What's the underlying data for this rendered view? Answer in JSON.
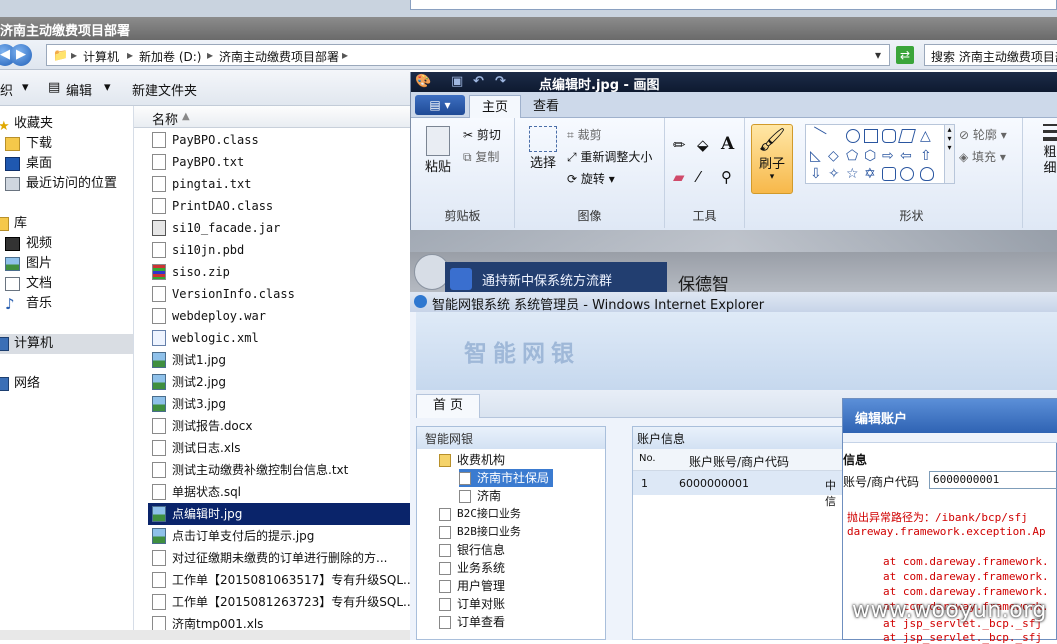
{
  "explorer": {
    "title": "济南主动缴费项目部署",
    "breadcrumb": [
      "计算机",
      "新加卷 (D:)",
      "济南主动缴费项目部署"
    ],
    "search_placeholder": "搜索 济南主动缴费项目部署",
    "toolbar": {
      "organize": "织",
      "edit": "编辑",
      "new_folder": "新建文件夹"
    },
    "column_name": "名称",
    "nav": [
      {
        "label": "收藏夹",
        "icon": "star-icon"
      },
      {
        "label": "下载",
        "icon": "download-folder-icon"
      },
      {
        "label": "桌面",
        "icon": "desktop-icon"
      },
      {
        "label": "最近访问的位置",
        "icon": "recent-places-icon"
      },
      {
        "label": "库",
        "icon": "library-icon"
      },
      {
        "label": "视频",
        "icon": "video-icon"
      },
      {
        "label": "图片",
        "icon": "pictures-icon"
      },
      {
        "label": "文档",
        "icon": "documents-icon"
      },
      {
        "label": "音乐",
        "icon": "music-icon"
      },
      {
        "label": "计算机",
        "icon": "computer-icon"
      },
      {
        "label": "网络",
        "icon": "network-icon"
      }
    ],
    "files": [
      {
        "name": "PayBPO.class",
        "type": "file"
      },
      {
        "name": "PayBPO.txt",
        "type": "file"
      },
      {
        "name": "pingtai.txt",
        "type": "file"
      },
      {
        "name": "PrintDAO.class",
        "type": "file"
      },
      {
        "name": "si10_facade.jar",
        "type": "jar"
      },
      {
        "name": "si10jn.pbd",
        "type": "file"
      },
      {
        "name": "siso.zip",
        "type": "zip"
      },
      {
        "name": "VersionInfo.class",
        "type": "file"
      },
      {
        "name": "webdeploy.war",
        "type": "file"
      },
      {
        "name": "weblogic.xml",
        "type": "cfg"
      },
      {
        "name": "测试1.jpg",
        "type": "img"
      },
      {
        "name": "测试2.jpg",
        "type": "img"
      },
      {
        "name": "测试3.jpg",
        "type": "img"
      },
      {
        "name": "测试报告.docx",
        "type": "file"
      },
      {
        "name": "测试日志.xls",
        "type": "file"
      },
      {
        "name": "测试主动缴费补缴控制台信息.txt",
        "type": "file"
      },
      {
        "name": "单据状态.sql",
        "type": "file"
      },
      {
        "name": "点编辑时.jpg",
        "type": "img"
      },
      {
        "name": "点击订单支付后的提示.jpg",
        "type": "img"
      },
      {
        "name": "对过征缴期未缴费的订单进行删除的方...",
        "type": "file"
      },
      {
        "name": "工作单【2015081063517】专有升级SQL...",
        "type": "file"
      },
      {
        "name": "工作单【2015081263723】专有升级SQL...",
        "type": "file"
      },
      {
        "name": "济南tmp001.xls",
        "type": "file"
      }
    ]
  },
  "paint": {
    "title": "点编辑时.jpg - 画图",
    "tabs": [
      "主页",
      "查看"
    ],
    "clipboard": {
      "paste": "粘贴",
      "cut": "剪切",
      "copy": "复制",
      "group": "剪贴板"
    },
    "image": {
      "select": "选择",
      "crop": "裁剪",
      "resize": "重新调整大小",
      "rotate": "旋转",
      "group": "图像"
    },
    "tools": {
      "group": "工具"
    },
    "brush": "刷子",
    "shapes": {
      "outline": "轮廓",
      "fill": "填充",
      "group": "形状"
    },
    "size_label": "粗细"
  },
  "background": {
    "title_left": "通持新中保系统方流群",
    "title_right": "保德智"
  },
  "ie": {
    "title": "智能网银系统 系统管理员 - Windows Internet Explorer",
    "logo": "智能网银",
    "home_tab": "首 页",
    "tree_header": "智能网银",
    "tree": [
      {
        "label": "收费机构",
        "indent": 1,
        "icon": "folder"
      },
      {
        "label": "济南市社保局",
        "indent": 2,
        "icon": "file",
        "selected": true
      },
      {
        "label": "济南",
        "indent": 2,
        "icon": "file"
      },
      {
        "label": "B2C接口业务",
        "indent": 1,
        "icon": "file"
      },
      {
        "label": "B2B接口业务",
        "indent": 1,
        "icon": "file"
      },
      {
        "label": "银行信息",
        "indent": 1,
        "icon": "file"
      },
      {
        "label": "业务系统",
        "indent": 1,
        "icon": "file"
      },
      {
        "label": "用户管理",
        "indent": 1,
        "icon": "file"
      },
      {
        "label": "订单对账",
        "indent": 1,
        "icon": "file"
      },
      {
        "label": "订单查看",
        "indent": 1,
        "icon": "file"
      }
    ],
    "acct": {
      "header": "账户信息",
      "col_no": "No.",
      "col_account": "账户账号/商户代码",
      "row_no": "1",
      "row_account": "6000000001",
      "row_extra": "中信"
    }
  },
  "dialog": {
    "title": "编辑账户",
    "section": "信息",
    "label": "账号/商户代码",
    "value": "6000000001",
    "error_lines": [
      "抛出异常路径为：/ibank/bcp/sfj",
      "dareway.framework.exception.Ap",
      "at com.dareway.framework.",
      "at com.dareway.framework.",
      "at com.dareway.framework.",
      "at com.dareway.framework.",
      "at jsp_servlet._bcp._sfj",
      "at jsp_servlet._bcp._sfj"
    ]
  },
  "watermark": "www.wooyun.org",
  "colors": {
    "selection": "#0a246a",
    "ie_header": "#2f63b3",
    "error": "#d00000"
  }
}
